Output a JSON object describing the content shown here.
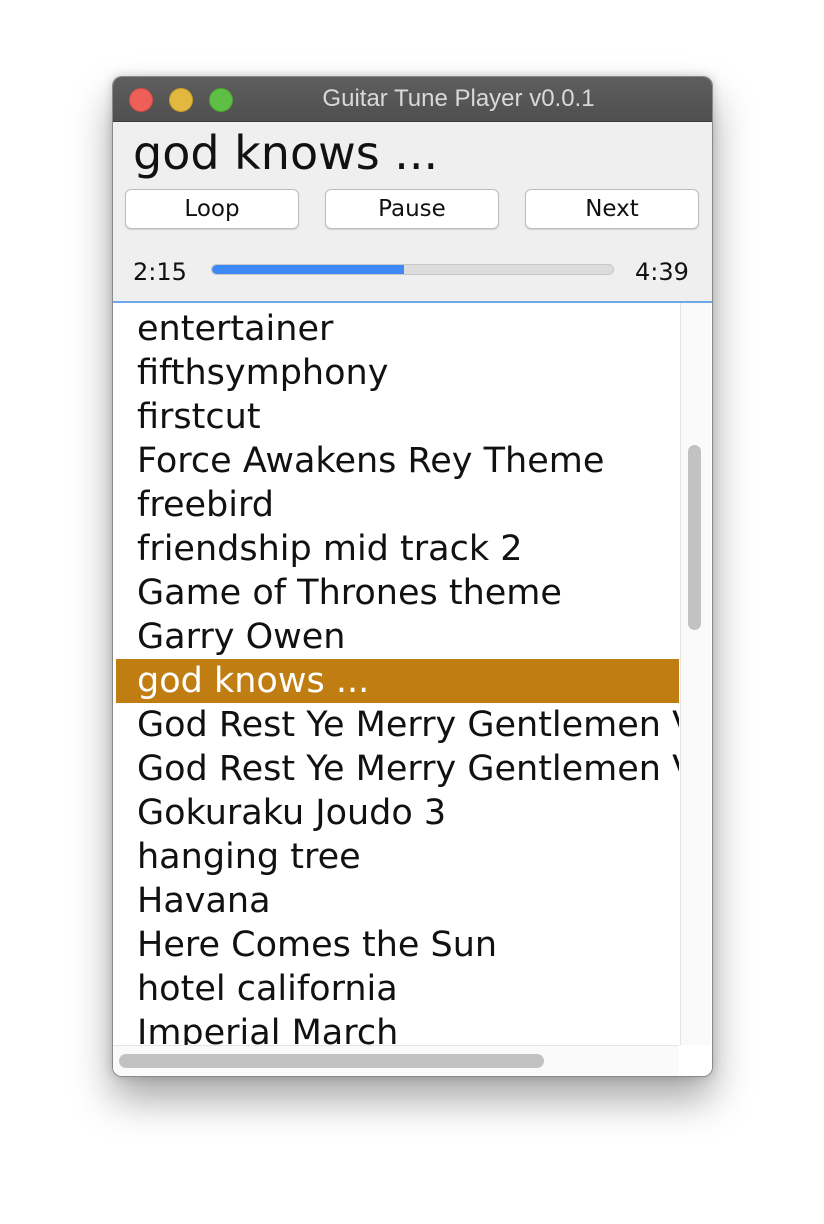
{
  "window": {
    "title": "Guitar Tune Player v0.0.1"
  },
  "now_playing": {
    "title": "god knows ..."
  },
  "controls": {
    "loop_label": "Loop",
    "pause_label": "Pause",
    "next_label": "Next"
  },
  "progress": {
    "elapsed": "2:15",
    "total": "4:39",
    "fraction": 0.48
  },
  "playlist": {
    "selected_index": 8,
    "items": [
      "entertainer",
      "fifthsymphony",
      "firstcut",
      "Force Awakens Rey Theme",
      "freebird",
      "friendship mid track 2",
      "Game of Thrones theme",
      "Garry Owen",
      "god knows ...",
      "God Rest Ye Merry Gentlemen V",
      "God Rest Ye Merry Gentlemen V",
      "Gokuraku Joudo 3",
      "hanging tree",
      "Havana",
      "Here Comes the Sun",
      "hotel california",
      "Imperial March"
    ]
  },
  "colors": {
    "selection": "#c07d11",
    "progress_fill": "#3d8af7",
    "focus_border": "#6fa8e8"
  }
}
